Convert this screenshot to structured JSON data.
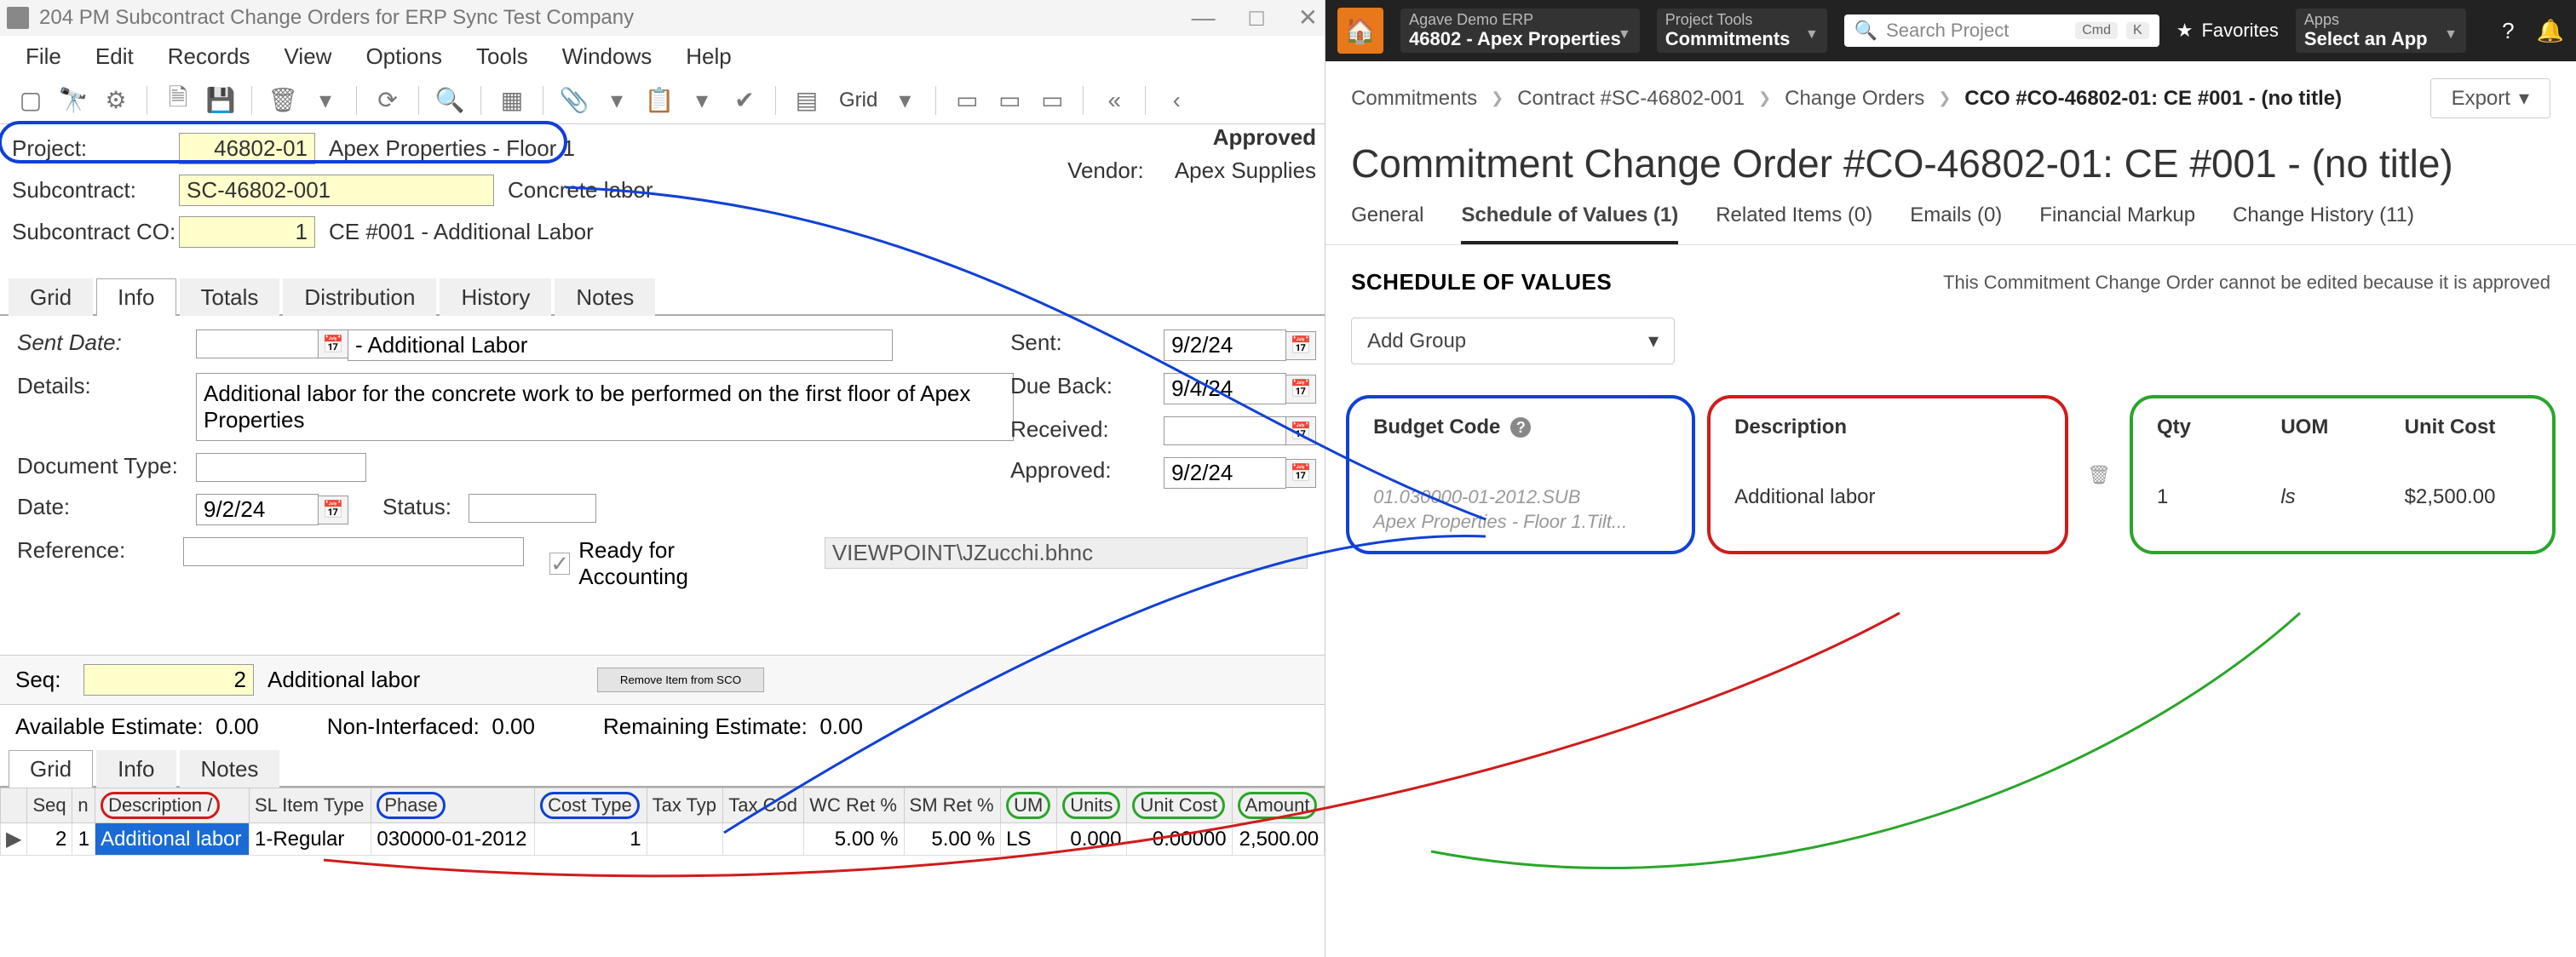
{
  "window": {
    "title": "204 PM Subcontract Change Orders for ERP Sync Test Company",
    "min": "—",
    "max": "□",
    "close": "✕"
  },
  "menu": {
    "file": "File",
    "edit": "Edit",
    "records": "Records",
    "view": "View",
    "options": "Options",
    "tools": "Tools",
    "windows": "Windows",
    "help": "Help"
  },
  "toolbar": {
    "grid": "Grid"
  },
  "form": {
    "project_lbl": "Project:",
    "project_num": "46802-01",
    "project_name": "Apex Properties - Floor 1",
    "subcontract_lbl": "Subcontract:",
    "subcontract_num": "SC-46802-001",
    "subcontract_name": "Concrete labor",
    "sco_lbl": "Subcontract CO:",
    "sco_num": "1",
    "sco_name": "CE #001 - Additional Labor",
    "status_block": {
      "approved": "Approved",
      "vendor_lbl": "Vendor:",
      "vendor": "Apex Supplies"
    }
  },
  "tabs": {
    "grid": "Grid",
    "info": "Info",
    "totals": "Totals",
    "distribution": "Distribution",
    "history": "History",
    "notes": "Notes"
  },
  "info": {
    "sent_date_lbl": "Sent Date:",
    "sent_date_suffix": "- Additional Labor",
    "details_lbl": "Details:",
    "details": "Additional labor for the concrete work to be performed on the first floor of Apex Properties",
    "doc_type_lbl": "Document Type:",
    "date_lbl": "Date:",
    "date": "9/2/24",
    "status_lbl": "Status:",
    "reference_lbl": "Reference:",
    "ready_lbl": "Ready for Accounting",
    "path": "VIEWPOINT\\JZucchi.bhnc",
    "right": {
      "sent_lbl": "Sent:",
      "sent": "9/2/24",
      "due_lbl": "Due Back:",
      "due": "9/4/24",
      "recv_lbl": "Received:",
      "recv": "",
      "appr_lbl": "Approved:",
      "appr": "9/2/24"
    }
  },
  "seq": {
    "lbl": "Seq:",
    "num": "2",
    "name": "Additional labor",
    "remove_btn": "Remove Item from SCO"
  },
  "est": {
    "avail_lbl": "Available Estimate:",
    "avail": "0.00",
    "noninterf_lbl": "Non-Interfaced:",
    "noninterf": "0.00",
    "remain_lbl": "Remaining Estimate:",
    "remain": "0.00"
  },
  "subtabs": {
    "grid": "Grid",
    "info": "Info",
    "notes": "Notes"
  },
  "grid_headers": {
    "seq": "Seq",
    "n": "n",
    "desc": "Description /",
    "sl": "SL Item Type",
    "phase": "Phase",
    "ct": "Cost Type",
    "tt": "Tax Typ",
    "tc": "Tax Cod",
    "wc": "WC Ret %",
    "sm": "SM Ret %",
    "um": "UM",
    "units": "Units",
    "uc": "Unit Cost",
    "amt": "Amount"
  },
  "grid_row": {
    "seq": "2",
    "n": "1",
    "desc": "Additional labor",
    "sl": "1-Regular",
    "phase": "030000-01-2012",
    "ct": "1",
    "tt": "",
    "tc": "",
    "wc": "5.00 %",
    "sm": "5.00 %",
    "um": "LS",
    "units": "0.000",
    "uc": "0.00000",
    "amt": "2,500.00"
  },
  "web": {
    "erp_small": "Agave Demo ERP",
    "erp_big": "46802 - Apex Properties",
    "tools_small": "Project Tools",
    "tools_big": "Commitments",
    "search_ph": "Search Project",
    "cmd": "Cmd",
    "k": "K",
    "fav": "Favorites",
    "apps_small": "Apps",
    "apps_big": "Select an App",
    "crumbs": {
      "c1": "Commitments",
      "c2": "Contract #SC-46802-001",
      "c3": "Change Orders",
      "c4": "CCO #CO-46802-01: CE #001 - (no title)"
    },
    "export": "Export",
    "title": "Commitment Change Order #CO-46802-01: CE #001 - (no title)",
    "tabs": {
      "general": "General",
      "sov": "Schedule of Values (1)",
      "related": "Related Items (0)",
      "emails": "Emails (0)",
      "fin": "Financial Markup",
      "hist": "Change History (11)"
    },
    "sov_head": "SCHEDULE OF VALUES",
    "sov_note": "This Commitment Change Order cannot be edited because it is approved",
    "add_group": "Add Group",
    "cols": {
      "budget": "Budget Code",
      "budget_line1": "01.030000-01-2012.SUB",
      "budget_line2": "Apex Properties - Floor 1.Tilt...",
      "desc": "Description",
      "desc_val": "Additional labor",
      "qty": "Qty",
      "qty_val": "1",
      "uom": "UOM",
      "uom_val": "ls",
      "uc": "Unit Cost",
      "uc_val": "$2,500.00"
    }
  }
}
